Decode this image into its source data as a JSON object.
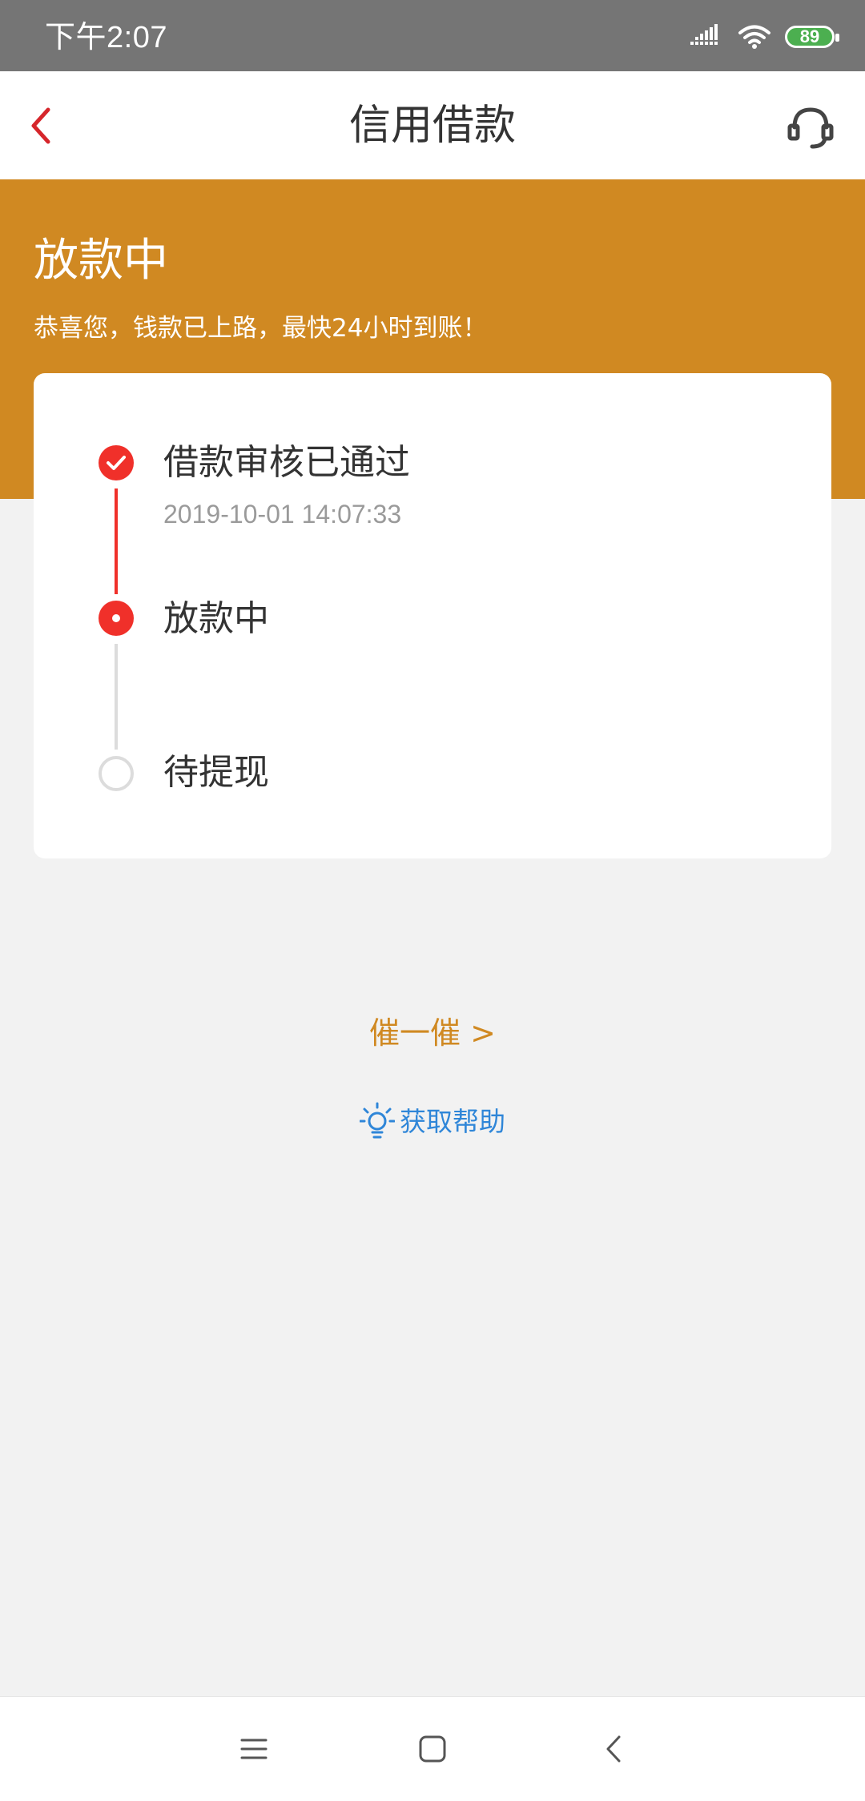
{
  "status_bar": {
    "time": "下午2:07",
    "battery_level": "89",
    "icons": [
      "signal-icon",
      "wifi-icon",
      "battery-icon"
    ]
  },
  "nav": {
    "title": "信用借款",
    "back_icon": "back-chevron-icon",
    "service_icon": "headset-icon"
  },
  "header": {
    "status": "放款中",
    "message": "恭喜您，钱款已上路，最快24小时到账！"
  },
  "progress": {
    "steps": [
      {
        "label": "借款审核已通过",
        "time": "2019-10-01 14:07:33",
        "state": "done"
      },
      {
        "label": "放款中",
        "time": "",
        "state": "current"
      },
      {
        "label": "待提现",
        "time": "",
        "state": "pending"
      }
    ]
  },
  "actions": {
    "urge_label": "催一催 >",
    "help_label": "获取帮助",
    "help_icon": "lightbulb-icon"
  },
  "colors": {
    "brand_orange": "#d08922",
    "progress_red": "#f0302a",
    "link_blue": "#2f86d8",
    "status_bar_gray": "#757575"
  },
  "system_nav": {
    "icons": [
      "menu-icon",
      "home-icon",
      "back-icon"
    ]
  }
}
